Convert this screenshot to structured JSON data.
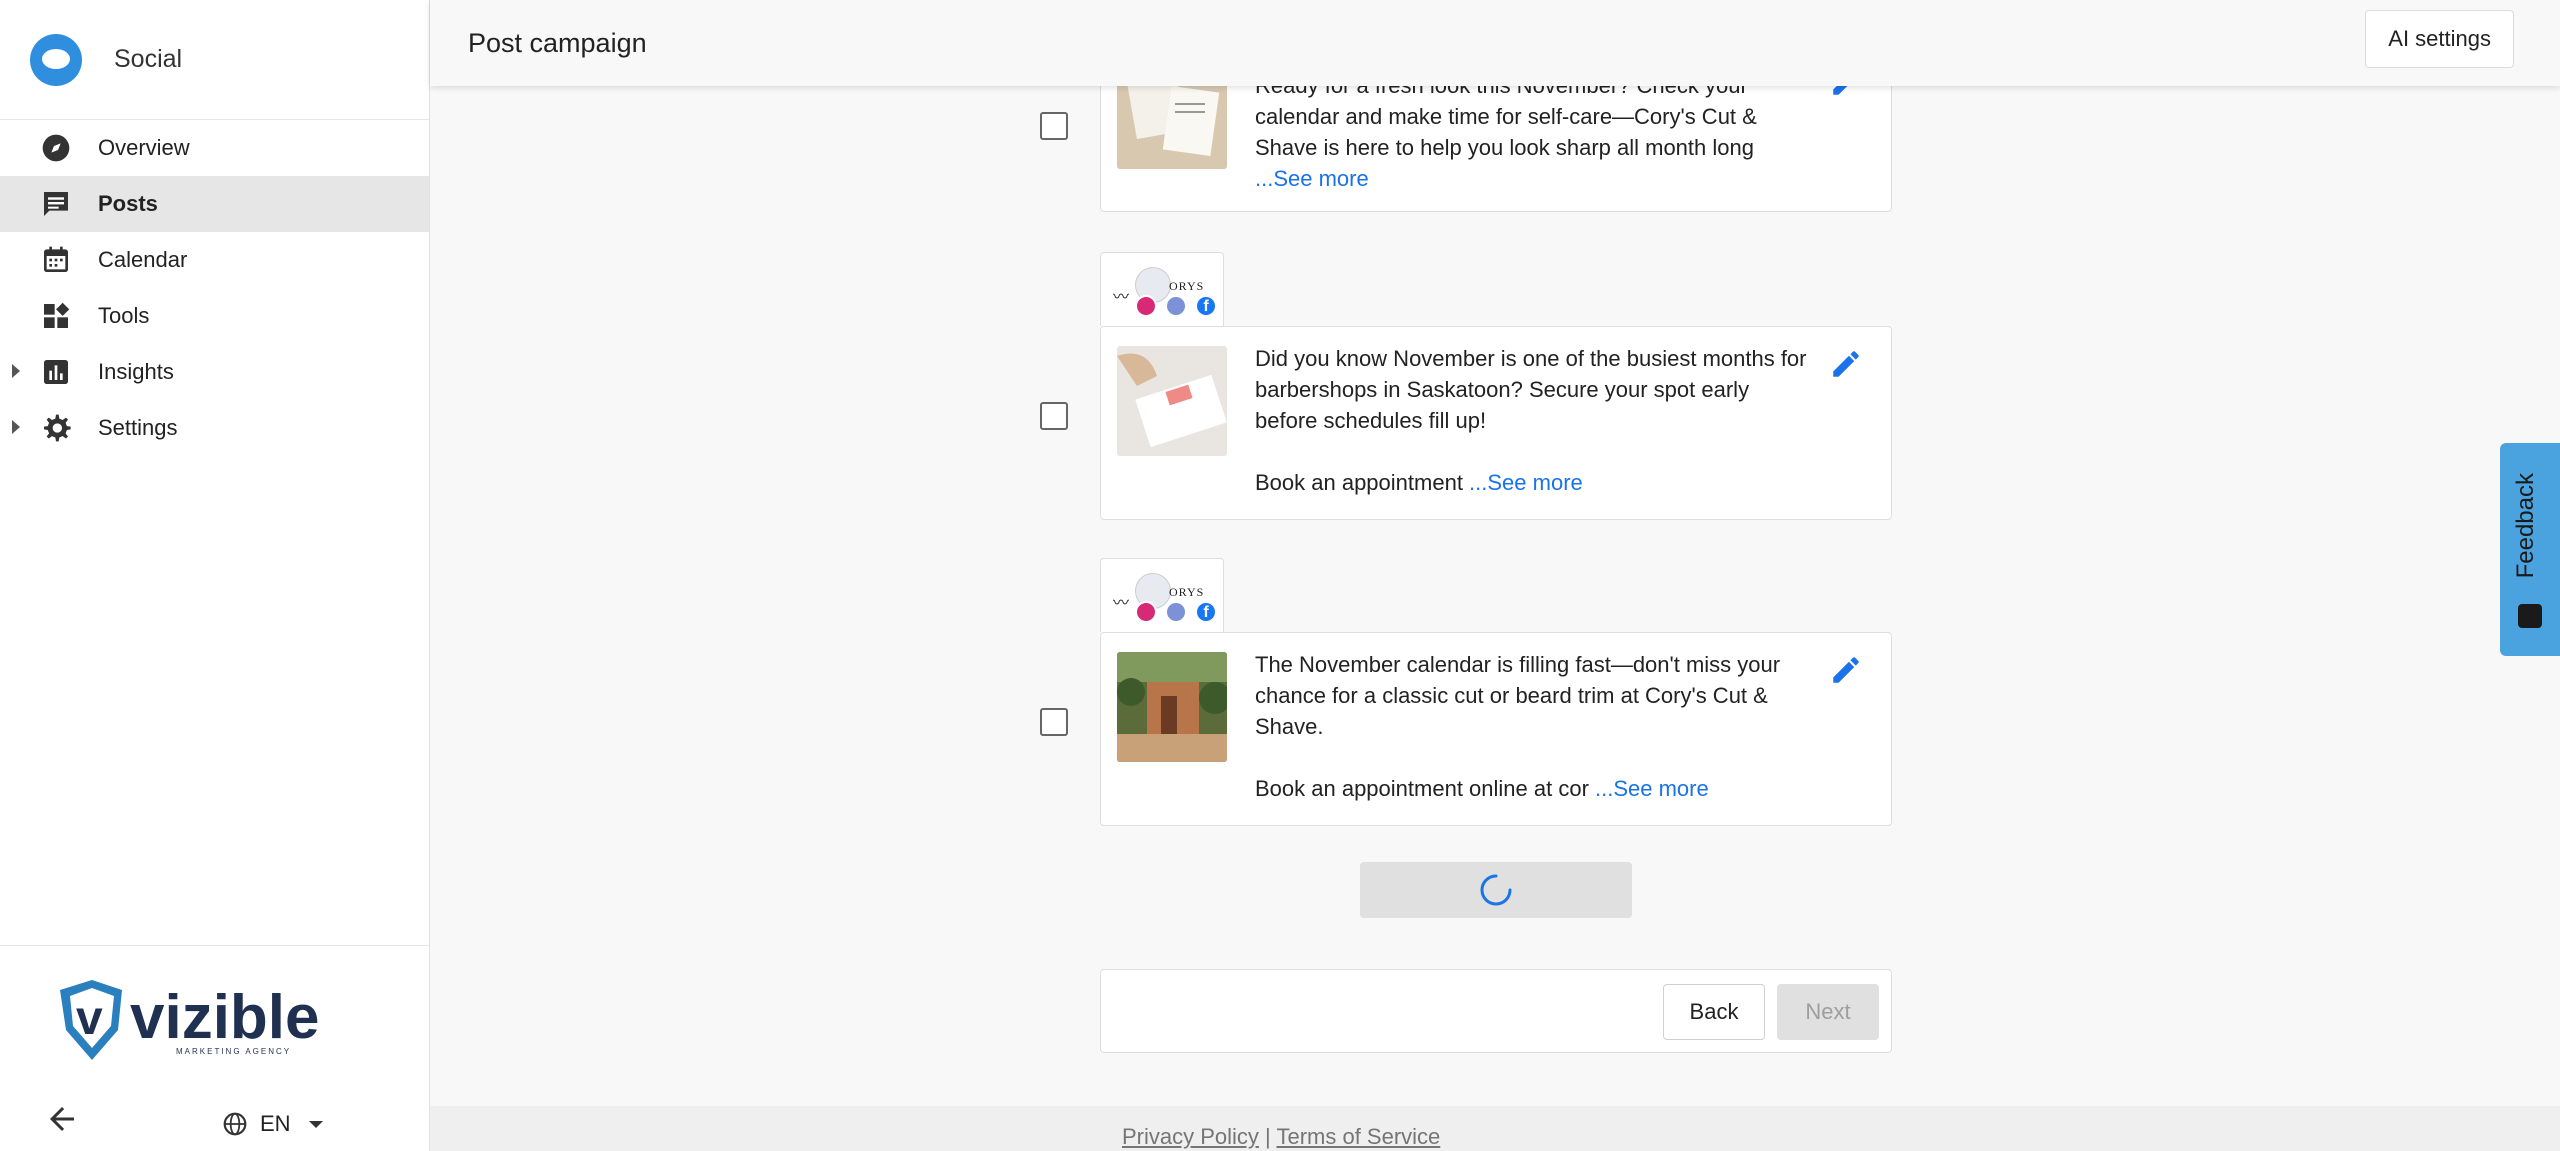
{
  "app": {
    "name": "Social"
  },
  "header": {
    "title": "Post campaign",
    "ai_settings_label": "AI settings"
  },
  "sidebar": {
    "items": [
      {
        "label": "Overview",
        "icon": "compass-icon"
      },
      {
        "label": "Posts",
        "icon": "chat-icon",
        "active": true
      },
      {
        "label": "Calendar",
        "icon": "calendar-icon"
      },
      {
        "label": "Tools",
        "icon": "tools-icon"
      },
      {
        "label": "Insights",
        "icon": "bar-chart-icon",
        "expandable": true
      },
      {
        "label": "Settings",
        "icon": "gear-icon",
        "expandable": true
      }
    ],
    "logo_text": "vizible",
    "logo_subtext": "MARKETING AGENCY",
    "language": "EN"
  },
  "posts": [
    {
      "text": "Ready for a fresh look this November? Check your calendar and make time for self-care—Cory's Cut & Shave is here to help you look sharp all month long",
      "see_more": "...See more"
    },
    {
      "text_line1": "Did you know November is one of the busiest months for barbershops in Saskatoon? Secure your spot early before schedules fill up!",
      "text_line2": "Book an appointment ",
      "see_more": "...See more",
      "avatar_text": "ORYS"
    },
    {
      "text_line1": "The November calendar is filling fast—don't miss your chance for a classic cut or beard trim at Cory's Cut & Shave.",
      "text_line2": "Book an appointment online at cor ",
      "see_more": "...See more",
      "avatar_text": "ORYS"
    }
  ],
  "actions": {
    "back_label": "Back",
    "next_label": "Next"
  },
  "footer": {
    "privacy": "Privacy Policy",
    "separator": " | ",
    "terms": "Terms of Service"
  },
  "feedback": {
    "label": "Feedback"
  },
  "colors": {
    "accent": "#1a73e8",
    "brand": "#2f8fde",
    "feedback": "#4aa3df"
  }
}
